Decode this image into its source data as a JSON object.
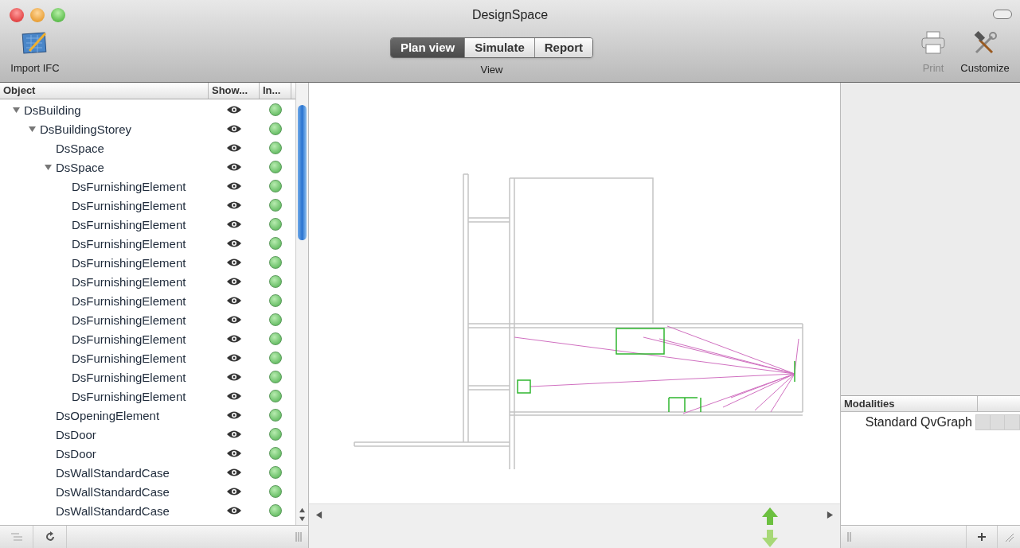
{
  "window": {
    "title": "DesignSpace"
  },
  "toolbar": {
    "left": [
      {
        "label": "Import IFC",
        "disabled": false
      }
    ],
    "view_tabs": [
      {
        "label": "Plan view",
        "selected": true
      },
      {
        "label": "Simulate",
        "selected": false
      },
      {
        "label": "Report",
        "selected": false
      }
    ],
    "view_label": "View",
    "right": [
      {
        "label": "Print",
        "disabled": true,
        "kind": "print"
      },
      {
        "label": "Customize",
        "disabled": false,
        "kind": "tools"
      }
    ]
  },
  "tree": {
    "columns": [
      "Object",
      "Show...",
      "In..."
    ],
    "items": [
      {
        "name": "DsBuilding",
        "expanded": true,
        "visible": true,
        "children": [
          {
            "name": "DsBuildingStorey",
            "expanded": true,
            "visible": true,
            "children": [
              {
                "name": "DsSpace",
                "visible": true
              },
              {
                "name": "DsSpace",
                "expanded": true,
                "visible": true,
                "children": [
                  {
                    "name": "DsFurnishingElement",
                    "visible": true
                  },
                  {
                    "name": "DsFurnishingElement",
                    "visible": true
                  },
                  {
                    "name": "DsFurnishingElement",
                    "visible": true
                  },
                  {
                    "name": "DsFurnishingElement",
                    "visible": true
                  },
                  {
                    "name": "DsFurnishingElement",
                    "visible": true
                  },
                  {
                    "name": "DsFurnishingElement",
                    "visible": true
                  },
                  {
                    "name": "DsFurnishingElement",
                    "visible": true
                  },
                  {
                    "name": "DsFurnishingElement",
                    "visible": true
                  },
                  {
                    "name": "DsFurnishingElement",
                    "visible": true
                  },
                  {
                    "name": "DsFurnishingElement",
                    "visible": true
                  },
                  {
                    "name": "DsFurnishingElement",
                    "visible": true
                  },
                  {
                    "name": "DsFurnishingElement",
                    "visible": true
                  }
                ]
              },
              {
                "name": "DsOpeningElement",
                "visible": true
              },
              {
                "name": "DsDoor",
                "visible": true
              },
              {
                "name": "DsDoor",
                "visible": true
              },
              {
                "name": "DsWallStandardCase",
                "visible": true
              },
              {
                "name": "DsWallStandardCase",
                "visible": true
              },
              {
                "name": "DsWallStandardCase",
                "visible": true
              }
            ]
          }
        ]
      }
    ]
  },
  "modalities": {
    "header": "Modalities",
    "items": [
      {
        "name": "Standard QvGraph"
      }
    ]
  }
}
